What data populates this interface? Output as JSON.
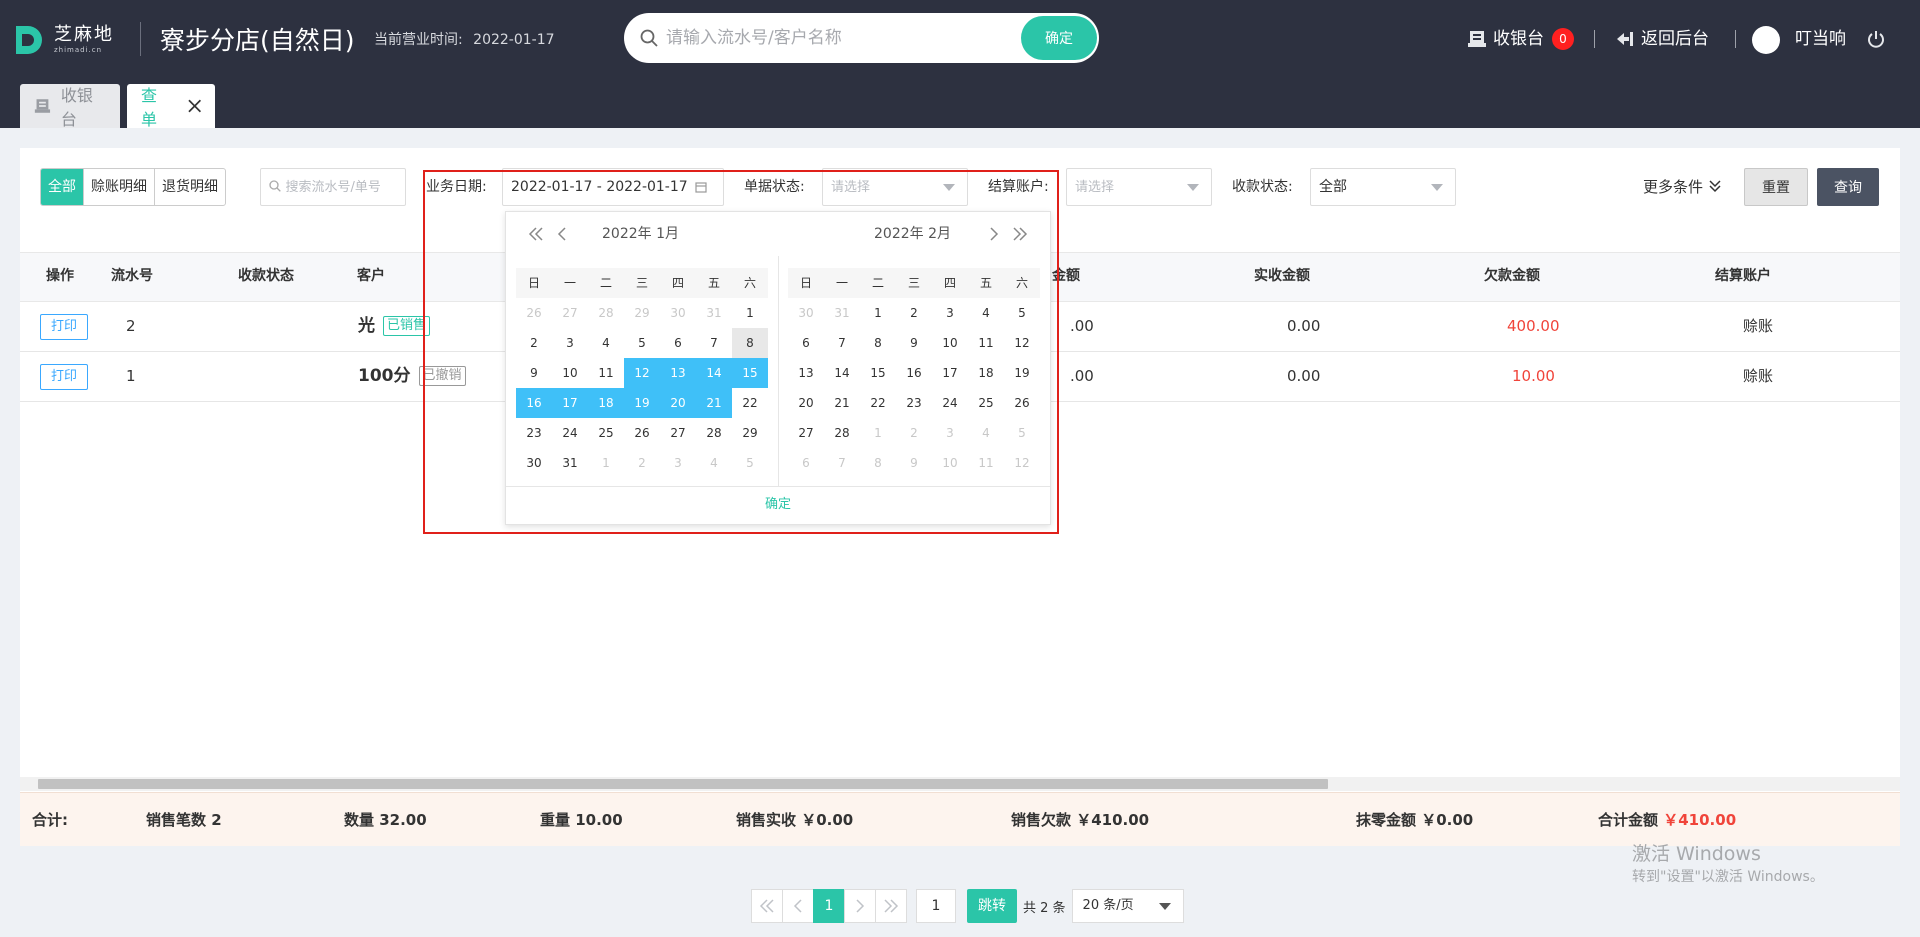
{
  "header": {
    "logo_text": "芝麻地",
    "logo_sub": "zhimadi.cn",
    "store_name": "寮步分店(自然日)",
    "biz_time_label": "当前营业时间:",
    "biz_time_value": "2022-01-17",
    "search_placeholder": "请输入流水号/客户名称",
    "search_button": "确定",
    "cashier_label": "收银台",
    "cashier_badge": "0",
    "back_label": "返回后台",
    "user_name": "叮当响"
  },
  "tabs": [
    {
      "label": "收银台"
    },
    {
      "label": "查单"
    }
  ],
  "filters": {
    "segments": [
      "全部",
      "赊账明细",
      "退货明细"
    ],
    "search_placeholder": "搜索流水号/单号",
    "date_label": "业务日期:",
    "date_value": "2022-01-17 - 2022-01-17",
    "status_label": "单据状态:",
    "status_placeholder": "请选择",
    "account_label": "结算账户:",
    "account_placeholder": "请选择",
    "pay_status_label": "收款状态:",
    "pay_status_value": "全部",
    "more_label": "更多条件",
    "reset_label": "重置",
    "query_label": "查询"
  },
  "calendar": {
    "left_title": "2022年  1月",
    "right_title": "2022年  2月",
    "weekdays": [
      "日",
      "一",
      "二",
      "三",
      "四",
      "五",
      "六"
    ],
    "left_days": [
      [
        "26",
        "o"
      ],
      [
        "27",
        "o"
      ],
      [
        "28",
        "o"
      ],
      [
        "29",
        "o"
      ],
      [
        "30",
        "o"
      ],
      [
        "31",
        "o"
      ],
      [
        "1",
        ""
      ],
      [
        "2",
        ""
      ],
      [
        "3",
        ""
      ],
      [
        "4",
        ""
      ],
      [
        "5",
        ""
      ],
      [
        "6",
        ""
      ],
      [
        "7",
        ""
      ],
      [
        "8",
        "today"
      ],
      [
        "9",
        ""
      ],
      [
        "10",
        ""
      ],
      [
        "11",
        ""
      ],
      [
        "12",
        "sel"
      ],
      [
        "13",
        "sel"
      ],
      [
        "14",
        "sel"
      ],
      [
        "15",
        "sel"
      ],
      [
        "16",
        "sel"
      ],
      [
        "17",
        "sel"
      ],
      [
        "18",
        "sel"
      ],
      [
        "19",
        "sel"
      ],
      [
        "20",
        "sel"
      ],
      [
        "21",
        "sel"
      ],
      [
        "22",
        ""
      ],
      [
        "23",
        ""
      ],
      [
        "24",
        ""
      ],
      [
        "25",
        ""
      ],
      [
        "26",
        ""
      ],
      [
        "27",
        ""
      ],
      [
        "28",
        ""
      ],
      [
        "29",
        ""
      ],
      [
        "30",
        ""
      ],
      [
        "31",
        ""
      ],
      [
        "1",
        "o"
      ],
      [
        "2",
        "o"
      ],
      [
        "3",
        "o"
      ],
      [
        "4",
        "o"
      ],
      [
        "5",
        "o"
      ]
    ],
    "right_days": [
      [
        "30",
        "o"
      ],
      [
        "31",
        "o"
      ],
      [
        "1",
        ""
      ],
      [
        "2",
        ""
      ],
      [
        "3",
        ""
      ],
      [
        "4",
        ""
      ],
      [
        "5",
        ""
      ],
      [
        "6",
        ""
      ],
      [
        "7",
        ""
      ],
      [
        "8",
        ""
      ],
      [
        "9",
        ""
      ],
      [
        "10",
        ""
      ],
      [
        "11",
        ""
      ],
      [
        "12",
        ""
      ],
      [
        "13",
        ""
      ],
      [
        "14",
        ""
      ],
      [
        "15",
        ""
      ],
      [
        "16",
        ""
      ],
      [
        "17",
        ""
      ],
      [
        "18",
        ""
      ],
      [
        "19",
        ""
      ],
      [
        "20",
        ""
      ],
      [
        "21",
        ""
      ],
      [
        "22",
        ""
      ],
      [
        "23",
        ""
      ],
      [
        "24",
        ""
      ],
      [
        "25",
        ""
      ],
      [
        "26",
        ""
      ],
      [
        "27",
        ""
      ],
      [
        "28",
        ""
      ],
      [
        "1",
        "o"
      ],
      [
        "2",
        "o"
      ],
      [
        "3",
        "o"
      ],
      [
        "4",
        "o"
      ],
      [
        "5",
        "o"
      ],
      [
        "6",
        "o"
      ],
      [
        "7",
        "o"
      ],
      [
        "8",
        "o"
      ],
      [
        "9",
        "o"
      ],
      [
        "10",
        "o"
      ],
      [
        "11",
        "o"
      ],
      [
        "12",
        "o"
      ]
    ],
    "confirm": "确定"
  },
  "table": {
    "headers": {
      "op": "操作",
      "serial": "流水号",
      "pay_status": "收款状态",
      "customer": "客户",
      "amount_tail": "金额",
      "received": "实收金额",
      "owed": "欠款金额",
      "account": "结算账户"
    },
    "rows": [
      {
        "print": "打印",
        "serial": "2",
        "customer": "光",
        "tag": "已销售",
        "amount_tail": ".00",
        "received": "0.00",
        "owed": "400.00",
        "account": "赊账"
      },
      {
        "print": "打印",
        "serial": "1",
        "customer": "100分",
        "tag": "已撤销",
        "amount_tail": ".00",
        "received": "0.00",
        "owed": "10.00",
        "account": "赊账"
      }
    ]
  },
  "summary": {
    "total": "合计:",
    "sales_count": "销售笔数 2",
    "qty": "数量 32.00",
    "weight": "重量 10.00",
    "sales_received": "销售实收 ￥0.00",
    "sales_owed": "销售欠款 ￥410.00",
    "rounding": "抹零金额 ￥0.00",
    "total_amount_label": "合计金额",
    "total_amount_value": "￥410.00"
  },
  "pager": {
    "current": "1",
    "jump_value": "1",
    "jump_label": "跳转",
    "total": "共 2 条",
    "page_size": "20 条/页"
  },
  "watermark": {
    "line1": "激活 Windows",
    "line2": "转到\"设置\"以激活 Windows。"
  },
  "colors": {
    "accent": "#2bc5a8",
    "selected": "#3fc0f8",
    "danger": "#f0443a",
    "topbar": "#2d3140"
  }
}
